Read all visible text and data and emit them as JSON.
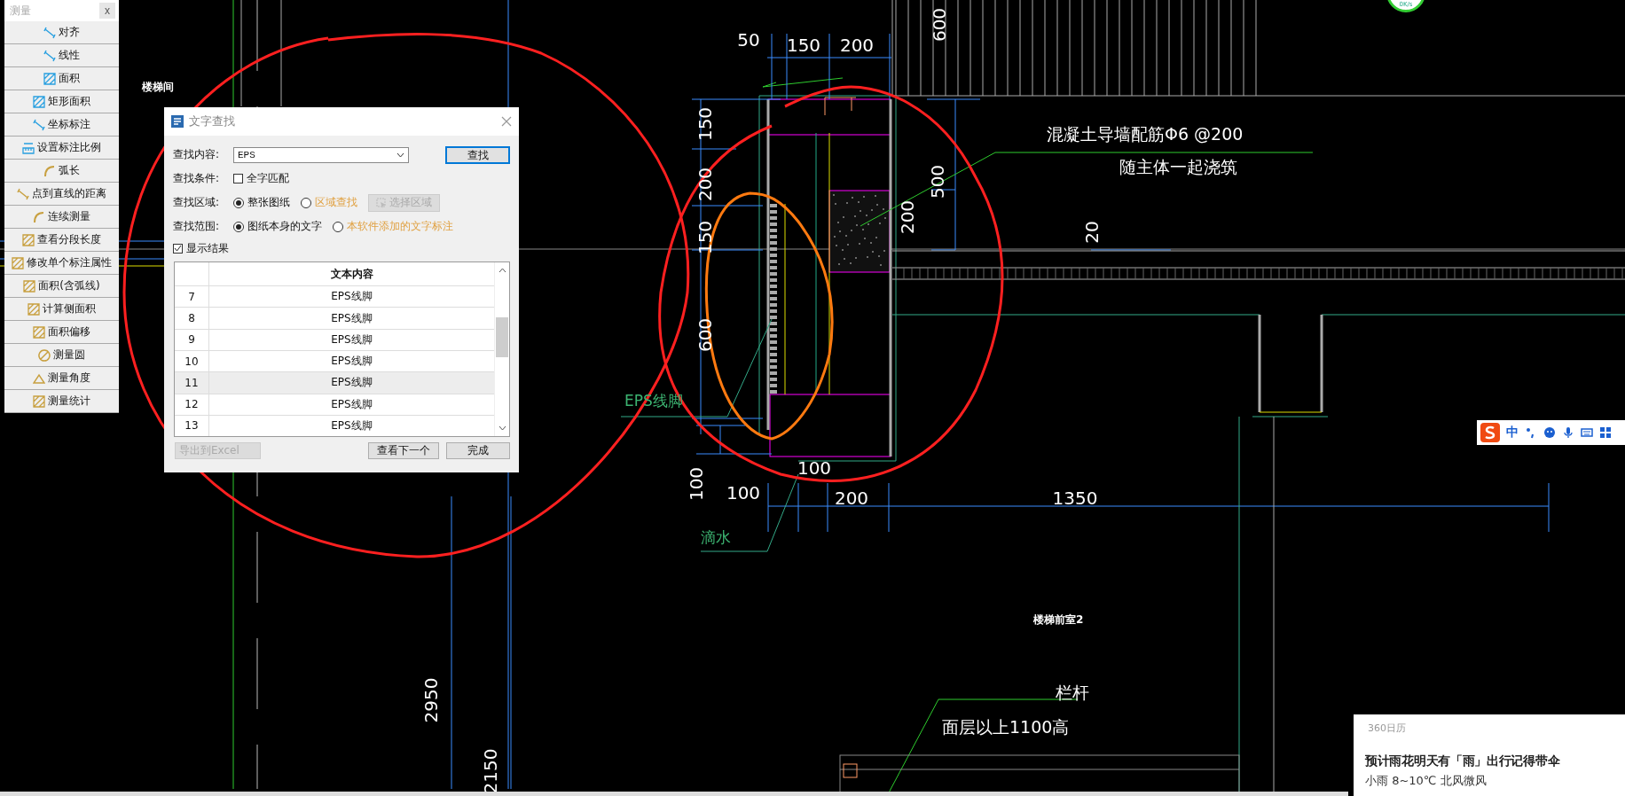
{
  "measure_panel": {
    "title": "测量",
    "close": "x",
    "items": [
      {
        "label": "对齐"
      },
      {
        "label": "线性"
      },
      {
        "label": "面积"
      },
      {
        "label": "矩形面积"
      },
      {
        "label": "坐标标注"
      },
      {
        "label": "设置标注比例"
      },
      {
        "label": "弧长"
      },
      {
        "label": "点到直线的距离"
      },
      {
        "label": "连续测量"
      },
      {
        "label": "查看分段长度"
      },
      {
        "label": "修改单个标注属性"
      },
      {
        "label": "面积(含弧线)"
      },
      {
        "label": "计算侧面积"
      },
      {
        "label": "面积偏移"
      },
      {
        "label": "测量圆"
      },
      {
        "label": "测量角度"
      },
      {
        "label": "测量统计"
      }
    ]
  },
  "find_dialog": {
    "title": "文字查找",
    "content": {
      "label": "查找内容:",
      "value": "EPS",
      "button": "查找"
    },
    "condition": {
      "label": "查找条件:",
      "option": "全字匹配",
      "checked": false
    },
    "area": {
      "label": "查找区域:",
      "options": [
        {
          "label": "整张图纸",
          "selected": true
        },
        {
          "label": "区域查找",
          "selected": false
        }
      ],
      "select_button": "选择区域",
      "select_disabled": true
    },
    "scope": {
      "label": "查找范围:",
      "options": [
        {
          "label": "图纸本身的文字",
          "selected": true
        },
        {
          "label": "本软件添加的文字标注",
          "selected": false
        }
      ]
    },
    "show_results": {
      "label": "显示结果",
      "checked": true
    },
    "results": {
      "columns": [
        "文本内容"
      ],
      "rows": [
        {
          "index": "7",
          "text": "EPS线脚",
          "selected": false
        },
        {
          "index": "8",
          "text": "EPS线脚",
          "selected": false
        },
        {
          "index": "9",
          "text": "EPS线脚",
          "selected": false
        },
        {
          "index": "10",
          "text": "EPS线脚",
          "selected": false
        },
        {
          "index": "11",
          "text": "EPS线脚",
          "selected": true
        },
        {
          "index": "12",
          "text": "EPS线脚",
          "selected": false
        },
        {
          "index": "13",
          "text": "EPS线脚",
          "selected": false
        }
      ]
    },
    "buttons": [
      {
        "label": "导出到Excel",
        "disabled": true
      },
      {
        "label": "查看下一个",
        "disabled": false
      },
      {
        "label": "完成",
        "disabled": false
      }
    ]
  },
  "canvas_labels": [
    {
      "text": "楼梯间",
      "kind": "room"
    },
    {
      "text": "50",
      "kind": "dimension"
    },
    {
      "text": "150",
      "kind": "dimension"
    },
    {
      "text": "200",
      "kind": "dimension"
    },
    {
      "text": "600",
      "kind": "dimension-vertical"
    },
    {
      "text": "150",
      "kind": "dimension-vertical"
    },
    {
      "text": "200",
      "kind": "dimension-vertical"
    },
    {
      "text": "150",
      "kind": "dimension-vertical"
    },
    {
      "text": "600",
      "kind": "dimension-vertical"
    },
    {
      "text": "500",
      "kind": "dimension-vertical"
    },
    {
      "text": "200",
      "kind": "dimension-vertical"
    },
    {
      "text": "20",
      "kind": "dimension-vertical"
    },
    {
      "text": "混凝土导墙配筋Φ6 @200",
      "kind": "note"
    },
    {
      "text": "随主体一起浇筑",
      "kind": "note"
    },
    {
      "text": "EPS线脚",
      "kind": "leader"
    },
    {
      "text": "100",
      "kind": "dimension-vertical"
    },
    {
      "text": "100",
      "kind": "dimension"
    },
    {
      "text": "100",
      "kind": "dimension"
    },
    {
      "text": "200",
      "kind": "dimension"
    },
    {
      "text": "1350",
      "kind": "dimension"
    },
    {
      "text": "滴水",
      "kind": "leader"
    },
    {
      "text": "楼梯前室2",
      "kind": "room"
    },
    {
      "text": "栏杆",
      "kind": "note"
    },
    {
      "text": "面层以上1100高",
      "kind": "note"
    },
    {
      "text": "2950",
      "kind": "dimension-vertical"
    },
    {
      "text": "2150",
      "kind": "dimension-vertical"
    }
  ],
  "network_speed": "0K/s",
  "ime_toolbar": {
    "mode": "中"
  },
  "calendar_popup": {
    "source": "360日历",
    "headline": "预计雨花明天有「雨」出行记得带伞",
    "detail": "小雨 8~10℃ 北风微风"
  }
}
